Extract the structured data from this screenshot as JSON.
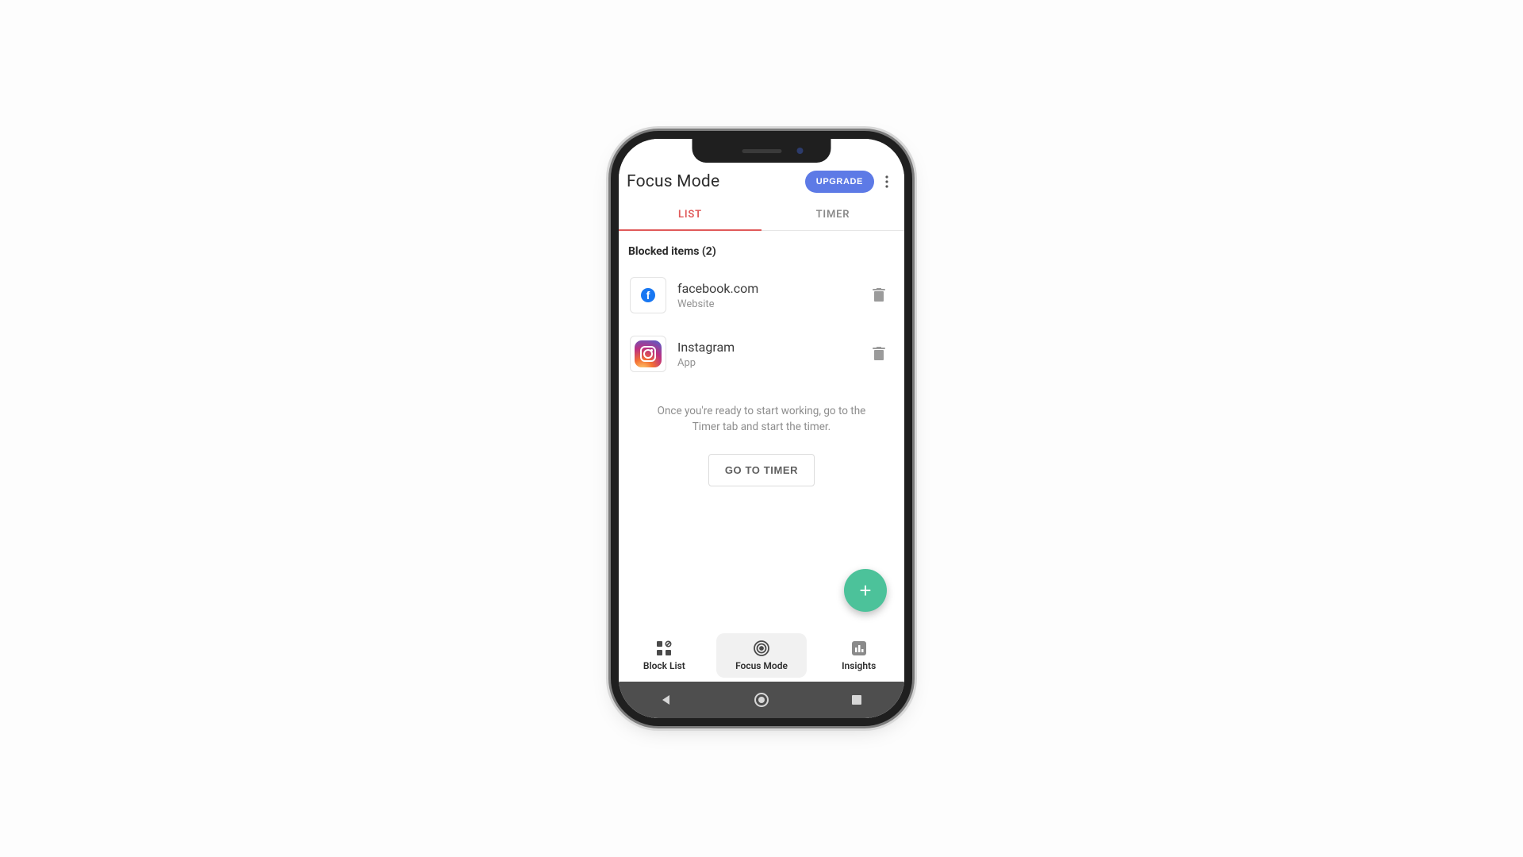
{
  "header": {
    "title": "Focus Mode",
    "upgrade_label": "UPGRADE"
  },
  "tabs": {
    "list": "LIST",
    "timer": "TIMER",
    "active": "list"
  },
  "section_heading": "Blocked items (2)",
  "items": [
    {
      "title": "facebook.com",
      "subtitle": "Website",
      "icon": "facebook-icon"
    },
    {
      "title": "Instagram",
      "subtitle": "App",
      "icon": "instagram-icon"
    }
  ],
  "hint": "Once you're ready to start working, go to the Timer tab and start the timer.",
  "goto_label": "GO TO TIMER",
  "fab_symbol": "+",
  "bottom_nav": {
    "block_list": "Block List",
    "focus_mode": "Focus Mode",
    "insights": "Insights",
    "active": "focus_mode"
  }
}
